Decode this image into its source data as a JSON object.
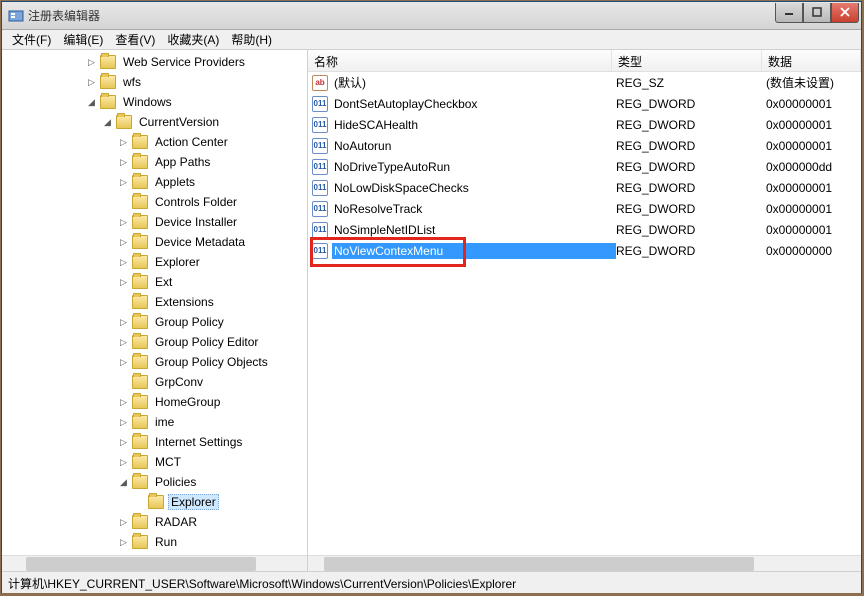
{
  "title": "注册表编辑器",
  "menu": {
    "file": "文件(F)",
    "edit": "编辑(E)",
    "view": "查看(V)",
    "fav": "收藏夹(A)",
    "help": "帮助(H)"
  },
  "tree": [
    {
      "indent": 84,
      "tw": "▷",
      "label": "Web Service Providers"
    },
    {
      "indent": 84,
      "tw": "▷",
      "label": "wfs"
    },
    {
      "indent": 84,
      "tw": "◢",
      "label": "Windows"
    },
    {
      "indent": 100,
      "tw": "◢",
      "label": "CurrentVersion"
    },
    {
      "indent": 116,
      "tw": "▷",
      "label": "Action Center"
    },
    {
      "indent": 116,
      "tw": "▷",
      "label": "App Paths"
    },
    {
      "indent": 116,
      "tw": "▷",
      "label": "Applets"
    },
    {
      "indent": 116,
      "tw": "",
      "label": "Controls Folder"
    },
    {
      "indent": 116,
      "tw": "▷",
      "label": "Device Installer"
    },
    {
      "indent": 116,
      "tw": "▷",
      "label": "Device Metadata"
    },
    {
      "indent": 116,
      "tw": "▷",
      "label": "Explorer"
    },
    {
      "indent": 116,
      "tw": "▷",
      "label": "Ext"
    },
    {
      "indent": 116,
      "tw": "",
      "label": "Extensions"
    },
    {
      "indent": 116,
      "tw": "▷",
      "label": "Group Policy"
    },
    {
      "indent": 116,
      "tw": "▷",
      "label": "Group Policy Editor"
    },
    {
      "indent": 116,
      "tw": "▷",
      "label": "Group Policy Objects"
    },
    {
      "indent": 116,
      "tw": "",
      "label": "GrpConv"
    },
    {
      "indent": 116,
      "tw": "▷",
      "label": "HomeGroup"
    },
    {
      "indent": 116,
      "tw": "▷",
      "label": "ime"
    },
    {
      "indent": 116,
      "tw": "▷",
      "label": "Internet Settings"
    },
    {
      "indent": 116,
      "tw": "▷",
      "label": "MCT"
    },
    {
      "indent": 116,
      "tw": "◢",
      "label": "Policies"
    },
    {
      "indent": 132,
      "tw": "",
      "label": "Explorer",
      "selected": true
    },
    {
      "indent": 116,
      "tw": "▷",
      "label": "RADAR"
    },
    {
      "indent": 116,
      "tw": "▷",
      "label": "Run"
    }
  ],
  "columns": {
    "name": "名称",
    "type": "类型",
    "data": "数据"
  },
  "values": [
    {
      "icon": "ab",
      "name": "(默认)",
      "type": "REG_SZ",
      "data": "(数值未设置)"
    },
    {
      "icon": "bin",
      "name": "DontSetAutoplayCheckbox",
      "type": "REG_DWORD",
      "data": "0x00000001"
    },
    {
      "icon": "bin",
      "name": "HideSCAHealth",
      "type": "REG_DWORD",
      "data": "0x00000001"
    },
    {
      "icon": "bin",
      "name": "NoAutorun",
      "type": "REG_DWORD",
      "data": "0x00000001"
    },
    {
      "icon": "bin",
      "name": "NoDriveTypeAutoRun",
      "type": "REG_DWORD",
      "data": "0x000000dd"
    },
    {
      "icon": "bin",
      "name": "NoLowDiskSpaceChecks",
      "type": "REG_DWORD",
      "data": "0x00000001"
    },
    {
      "icon": "bin",
      "name": "NoResolveTrack",
      "type": "REG_DWORD",
      "data": "0x00000001"
    },
    {
      "icon": "bin",
      "name": "NoSimpleNetIDList",
      "type": "REG_DWORD",
      "data": "0x00000001"
    },
    {
      "icon": "bin",
      "name": "NoViewContexMenu",
      "type": "REG_DWORD",
      "data": "0x00000000",
      "selected": true
    }
  ],
  "status": "计算机\\HKEY_CURRENT_USER\\Software\\Microsoft\\Windows\\CurrentVersion\\Policies\\Explorer"
}
